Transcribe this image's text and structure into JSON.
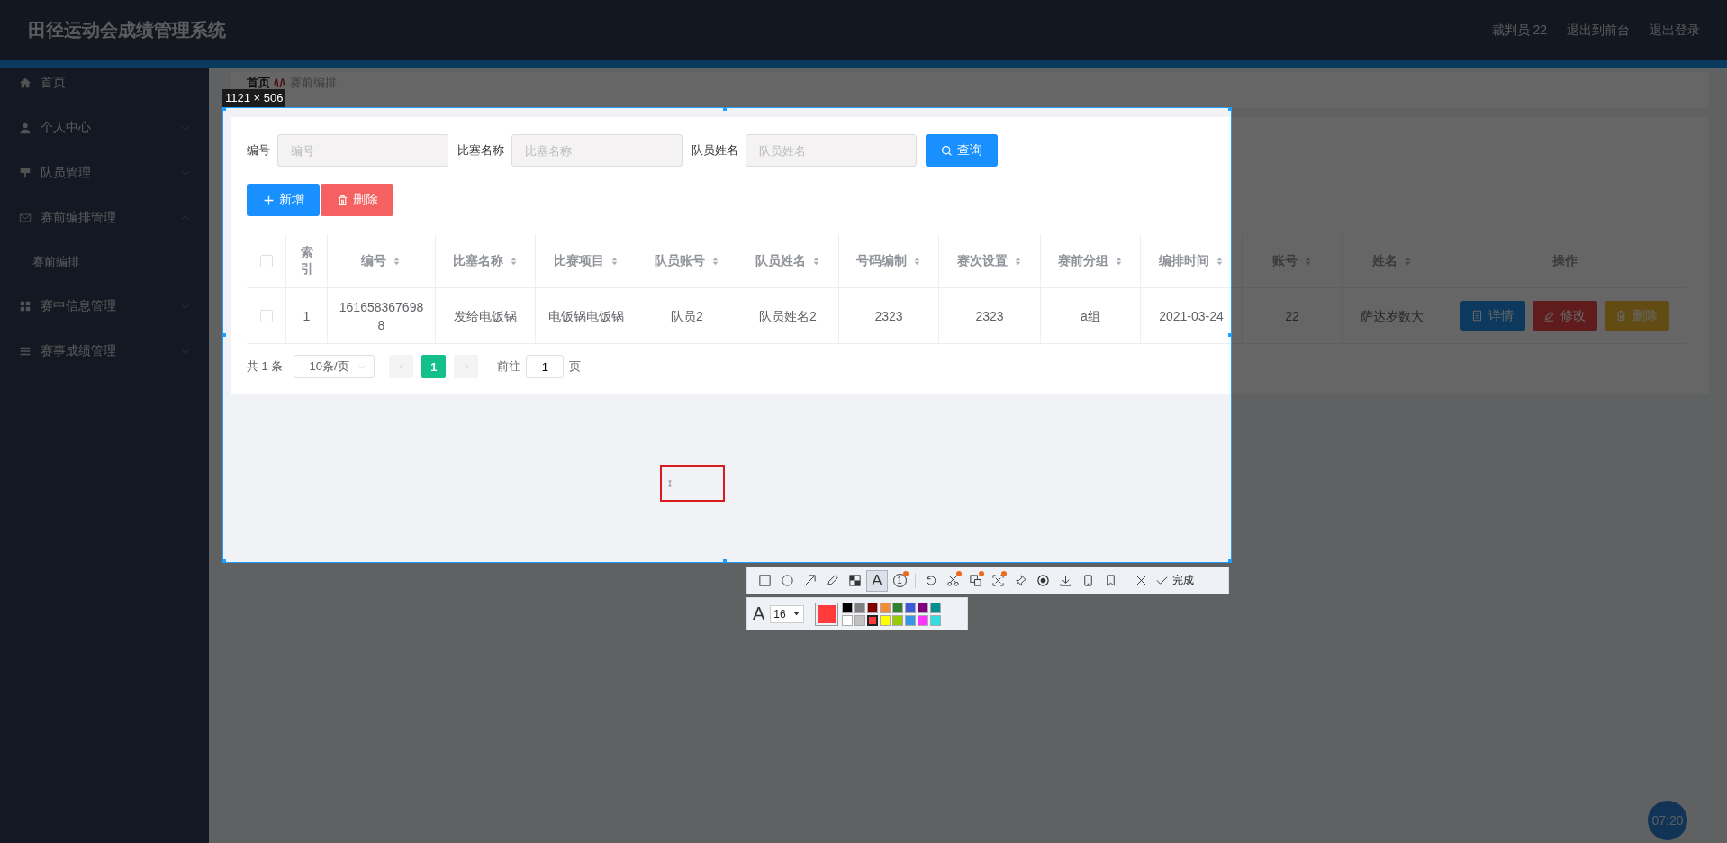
{
  "header": {
    "title": "田径运动会成绩管理系统",
    "links": [
      "裁判员 22",
      "退出到前台",
      "退出登录"
    ]
  },
  "sidebar": {
    "items": [
      {
        "label": "首页",
        "kind": "home"
      },
      {
        "label": "个人中心",
        "kind": "user",
        "expanded": false
      },
      {
        "label": "队员管理",
        "kind": "sign",
        "expanded": false
      },
      {
        "label": "赛前编排管理",
        "kind": "mail",
        "expanded": true,
        "children": [
          {
            "label": "赛前编排"
          }
        ]
      },
      {
        "label": "赛中信息管理",
        "kind": "grid",
        "expanded": false
      },
      {
        "label": "赛事成绩管理",
        "kind": "list",
        "expanded": false
      }
    ]
  },
  "breadcrumb": [
    "首页",
    "赛前编排"
  ],
  "search": {
    "fields": [
      {
        "label": "编号",
        "placeholder": "编号"
      },
      {
        "label": "比塞名称",
        "placeholder": "比塞名称"
      },
      {
        "label": "队员姓名",
        "placeholder": "队员姓名"
      }
    ],
    "button": "查询"
  },
  "actions": [
    {
      "kind": "add",
      "label": "新增"
    },
    {
      "kind": "delete",
      "label": "删除"
    }
  ],
  "table": {
    "all_checked": false,
    "columns": [
      {
        "label": "索引",
        "sortable": false
      },
      {
        "label": "编号",
        "sortable": true
      },
      {
        "label": "比塞名称",
        "sortable": true
      },
      {
        "label": "比赛项目",
        "sortable": true
      },
      {
        "label": "队员账号",
        "sortable": true
      },
      {
        "label": "队员姓名",
        "sortable": true
      },
      {
        "label": "号码编制",
        "sortable": true
      },
      {
        "label": "赛次设置",
        "sortable": true
      },
      {
        "label": "赛前分组",
        "sortable": true
      },
      {
        "label": "编排时间",
        "sortable": true
      },
      {
        "label": "账号",
        "sortable": true
      },
      {
        "label": "姓名",
        "sortable": true
      },
      {
        "label": "操作",
        "sortable": false
      }
    ],
    "rows": [
      {
        "checked": false,
        "cells": [
          "1",
          "1616583676988",
          "发给电饭锅",
          "电饭锅电饭锅",
          "队员2",
          "队员姓名2",
          "2323",
          "2323",
          "a组",
          "2021-03-24",
          "22",
          "萨达岁数大"
        ],
        "actions": [
          {
            "kind": "detail",
            "label": "详情"
          },
          {
            "kind": "edit",
            "label": "修改"
          },
          {
            "kind": "delete",
            "label": "删除"
          }
        ]
      }
    ]
  },
  "pagination": {
    "total": "共 1 条",
    "page_size": "10条/页",
    "pages": [
      {
        "label": "1",
        "selected": true
      }
    ],
    "goto_label": "前往",
    "goto_value": "1",
    "goto_suffix": "页"
  },
  "screenshot_tool": {
    "size_label": "1121 × 506",
    "tool_groups": [
      {
        "tools": [
          {
            "kind": "rect",
            "selected": false,
            "badge": false
          },
          {
            "kind": "ellipse",
            "selected": false,
            "badge": false
          },
          {
            "kind": "arrow",
            "selected": false,
            "badge": false
          },
          {
            "kind": "pencil",
            "selected": false,
            "badge": false
          },
          {
            "kind": "mosaic",
            "selected": false,
            "badge": false
          },
          {
            "kind": "text",
            "glyph": "A",
            "selected": true,
            "badge": false
          },
          {
            "kind": "number",
            "glyph": "1",
            "selected": false,
            "badge": true
          }
        ]
      },
      {
        "tools": [
          {
            "kind": "undo",
            "selected": false,
            "badge": false
          },
          {
            "kind": "scissors",
            "selected": false,
            "badge": true
          },
          {
            "kind": "translate",
            "selected": false,
            "badge": true
          },
          {
            "kind": "ocr",
            "selected": false,
            "badge": true
          },
          {
            "kind": "pin",
            "selected": false,
            "badge": false
          },
          {
            "kind": "record",
            "selected": false,
            "badge": false
          },
          {
            "kind": "download",
            "selected": false,
            "badge": false
          },
          {
            "kind": "phone",
            "selected": false,
            "badge": false
          },
          {
            "kind": "bookmark",
            "selected": false,
            "badge": false
          }
        ]
      },
      {
        "tools": [
          {
            "kind": "close",
            "selected": false,
            "badge": false
          },
          {
            "kind": "done",
            "label": "完成",
            "selected": false,
            "badge": false
          }
        ]
      }
    ],
    "font_glyph": "A",
    "font_size": "16",
    "palette": [
      {
        "color": "#000000",
        "selected": false
      },
      {
        "color": "#808080",
        "selected": false
      },
      {
        "color": "#800000",
        "selected": false
      },
      {
        "color": "#f28c38",
        "selected": false
      },
      {
        "color": "#308030",
        "selected": false
      },
      {
        "color": "#3b5bdb",
        "selected": false
      },
      {
        "color": "#800080",
        "selected": false
      },
      {
        "color": "#009090",
        "selected": false
      },
      {
        "color": "#ffffff",
        "selected": false
      },
      {
        "color": "#c0c0c0",
        "selected": false
      },
      {
        "color": "#ff3b3b",
        "selected": true
      },
      {
        "color": "#ffff00",
        "selected": false
      },
      {
        "color": "#99cc00",
        "selected": false
      },
      {
        "color": "#3399e6",
        "selected": false
      },
      {
        "color": "#ff33ff",
        "selected": false
      },
      {
        "color": "#33dddd",
        "selected": false
      }
    ]
  },
  "clock": "07:20"
}
